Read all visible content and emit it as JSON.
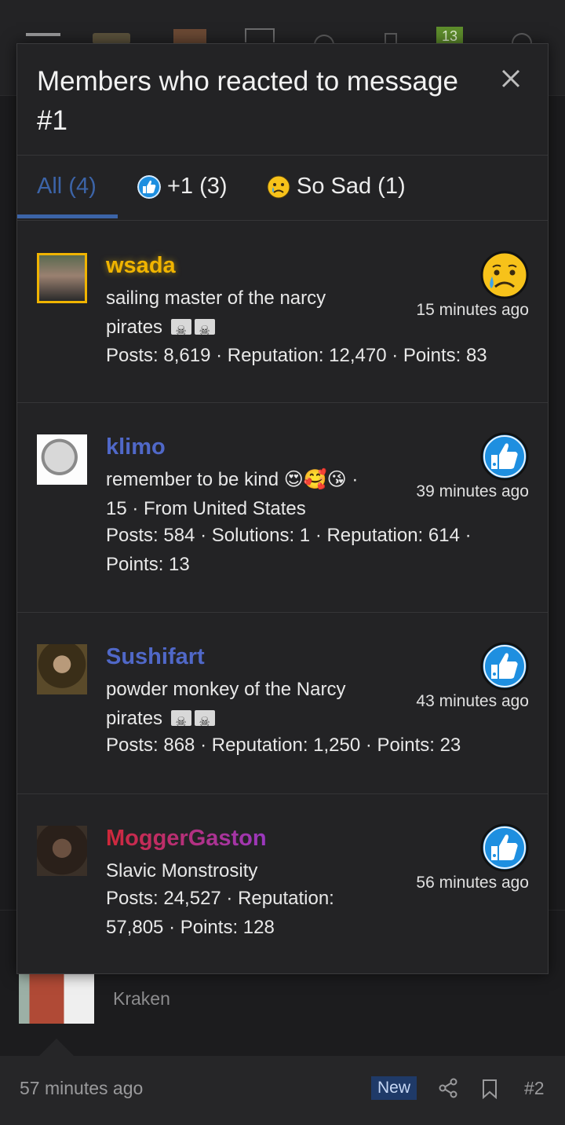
{
  "topbar": {
    "notification_count": "13"
  },
  "modal": {
    "title": "Members who reacted to message #1",
    "tabs": [
      {
        "label": "All (4)"
      },
      {
        "label": "+1 (3)",
        "icon": "thumbs-up-icon"
      },
      {
        "label": "So Sad (1)",
        "icon": "sad-face-icon"
      }
    ],
    "members": [
      {
        "name": "wsada",
        "name_color": "#f0b400",
        "title_line1": "sailing master of the narcy",
        "title_line2": "pirates",
        "stats_line1": "Posts: 8,619 · Reputation: 12,470 · Points: 83",
        "stats_line2": "",
        "time": "15 minutes ago",
        "reaction": "sad-face-icon"
      },
      {
        "name": "klimo",
        "name_color": "#5068c8",
        "title_line1": "remember to be kind 😍🥰😘 ·",
        "title_line2": "15 · From United States",
        "stats_line1": "Posts: 584 · Solutions: 1 · Reputation: 614 ·",
        "stats_line2": "Points: 13",
        "time": "39 minutes ago",
        "reaction": "thumbs-up-icon"
      },
      {
        "name": "Sushifart",
        "name_color": "#5068c8",
        "title_line1": "powder monkey of the Narcy",
        "title_line2": "pirates",
        "stats_line1": "Posts: 868 · Reputation: 1,250 · Points: 23",
        "stats_line2": "",
        "time": "43 minutes ago",
        "reaction": "thumbs-up-icon"
      },
      {
        "name": "MoggerGaston",
        "name_color": "#c8303c",
        "title_line1": "Slavic Monstrosity",
        "title_line2": "",
        "stats_line1": "Posts: 24,527 · Reputation:",
        "stats_line2": "57,805 · Points: 128",
        "time": "56 minutes ago",
        "reaction": "thumbs-up-icon"
      }
    ]
  },
  "background_post": {
    "author": "Kraken",
    "time": "57 minutes ago",
    "badge": "New",
    "post_number": "#2"
  }
}
